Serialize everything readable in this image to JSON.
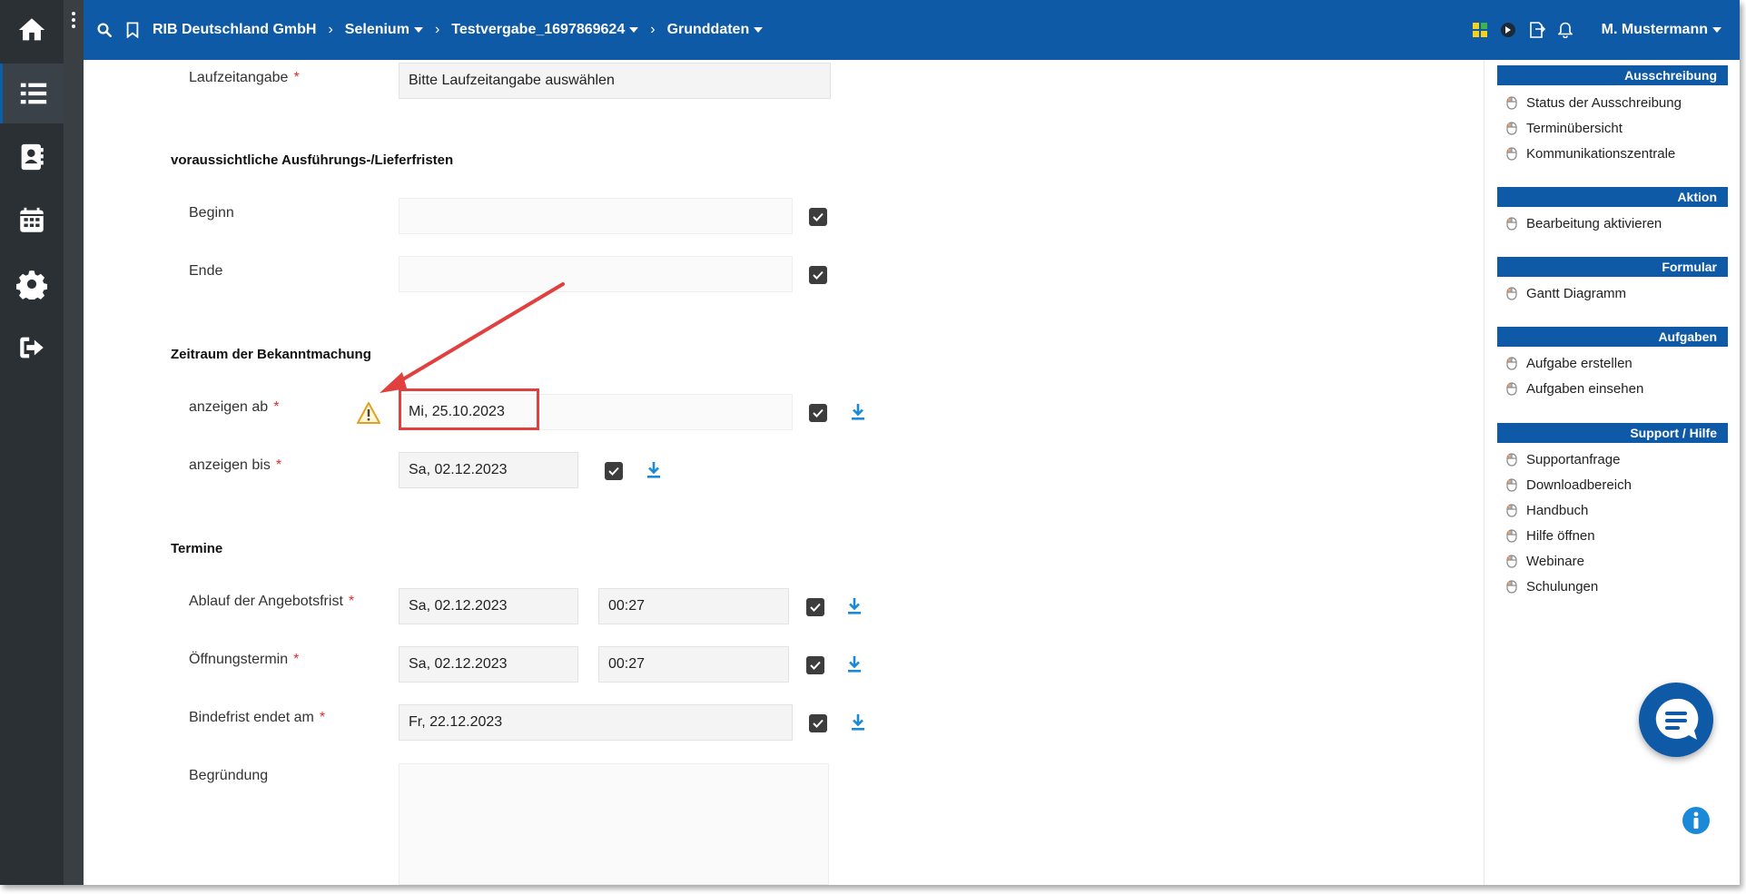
{
  "sidebar": {
    "items": [
      {
        "icon": "home-icon"
      },
      {
        "icon": "list-icon"
      },
      {
        "icon": "contacts-icon"
      },
      {
        "icon": "calendar-icon"
      },
      {
        "icon": "gear-icon"
      },
      {
        "icon": "logout-icon"
      }
    ]
  },
  "topbar": {
    "company": "RIB Deutschland GmbH",
    "project": "Selenium",
    "tender": "Testvergabe_1697869624",
    "page": "Grunddaten",
    "user": "M. Mustermann"
  },
  "form": {
    "laufzeit": {
      "label": "Laufzeitangabe",
      "placeholder": "Bitte Laufzeitangabe auswählen"
    },
    "section_fristen": "voraussichtliche Ausführungs-/Lieferfristen",
    "beginn": {
      "label": "Beginn",
      "value": ""
    },
    "ende": {
      "label": "Ende",
      "value": ""
    },
    "section_bekanntmachung": "Zeitraum der Bekanntmachung",
    "anzeigen_ab": {
      "label": "anzeigen ab",
      "value": "Mi, 25.10.2023"
    },
    "anzeigen_bis": {
      "label": "anzeigen bis",
      "value": "Sa, 02.12.2023"
    },
    "section_termine": "Termine",
    "angebotsfrist": {
      "label": "Ablauf der Angebotsfrist",
      "date": "Sa, 02.12.2023",
      "time": "00:27"
    },
    "oeffnung": {
      "label": "Öffnungstermin",
      "date": "Sa, 02.12.2023",
      "time": "00:27"
    },
    "bindefrist": {
      "label": "Bindefrist endet am",
      "value": "Fr, 22.12.2023"
    },
    "begruendung": {
      "label": "Begründung",
      "value": ""
    },
    "required_mark": "*"
  },
  "rpanel": {
    "sections": [
      {
        "title": "Ausschreibung",
        "items": [
          "Status der Ausschreibung",
          "Terminübersicht",
          "Kommunikationszentrale"
        ]
      },
      {
        "title": "Aktion",
        "items": [
          "Bearbeitung aktivieren"
        ]
      },
      {
        "title": "Formular",
        "items": [
          "Gantt Diagramm"
        ]
      },
      {
        "title": "Aufgaben",
        "items": [
          "Aufgabe erstellen",
          "Aufgaben einsehen"
        ]
      },
      {
        "title": "Support / Hilfe",
        "items": [
          "Supportanfrage",
          "Downloadbereich",
          "Handbuch",
          "Hilfe öffnen",
          "Webinare",
          "Schulungen"
        ]
      }
    ]
  },
  "colors": {
    "brand": "#0e5aa6",
    "sidebar": "#2b3035",
    "annotation": "#e0403e",
    "required": "#e03030"
  }
}
